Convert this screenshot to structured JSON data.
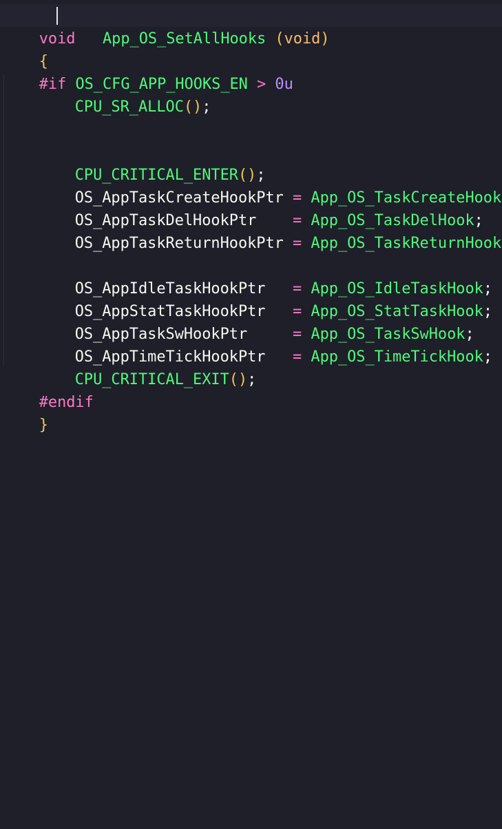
{
  "code": {
    "signature": {
      "return_type": "void",
      "name": "App_OS_SetAllHooks",
      "open_paren": "(",
      "param": "void",
      "close_paren": ")"
    },
    "open_brace": "{",
    "if_directive": {
      "keyword": "#if",
      "macro": "OS_CFG_APP_HOOKS_EN",
      "operator": ">",
      "value": "0u"
    },
    "sr_alloc": {
      "name": "CPU_SR_ALLOC",
      "parens": "()",
      "semicolon": ";"
    },
    "critical_enter": {
      "name": "CPU_CRITICAL_ENTER",
      "parens": "()",
      "semicolon": ";"
    },
    "assignments": [
      {
        "lhs": "OS_AppTaskCreateHookPtr",
        "pad": " ",
        "op": "=",
        "rhs": "App_OS_TaskCreateHook",
        "semi": ";"
      },
      {
        "lhs": "OS_AppTaskDelHookPtr",
        "pad": "    ",
        "op": "=",
        "rhs": "App_OS_TaskDelHook",
        "semi": ";"
      },
      {
        "lhs": "OS_AppTaskReturnHookPtr",
        "pad": " ",
        "op": "=",
        "rhs": "App_OS_TaskReturnHook",
        "semi": ";"
      },
      {
        "lhs": "OS_AppIdleTaskHookPtr",
        "pad": "   ",
        "op": "=",
        "rhs": "App_OS_IdleTaskHook",
        "semi": ";"
      },
      {
        "lhs": "OS_AppStatTaskHookPtr",
        "pad": "   ",
        "op": "=",
        "rhs": "App_OS_StatTaskHook",
        "semi": ";"
      },
      {
        "lhs": "OS_AppTaskSwHookPtr",
        "pad": "     ",
        "op": "=",
        "rhs": "App_OS_TaskSwHook",
        "semi": ";"
      },
      {
        "lhs": "OS_AppTimeTickHookPtr",
        "pad": "   ",
        "op": "=",
        "rhs": "App_OS_TimeTickHook",
        "semi": ";"
      }
    ],
    "critical_exit": {
      "name": "CPU_CRITICAL_EXIT",
      "parens": "()",
      "semicolon": ";"
    },
    "endif": "#endif",
    "close_brace": "}"
  }
}
